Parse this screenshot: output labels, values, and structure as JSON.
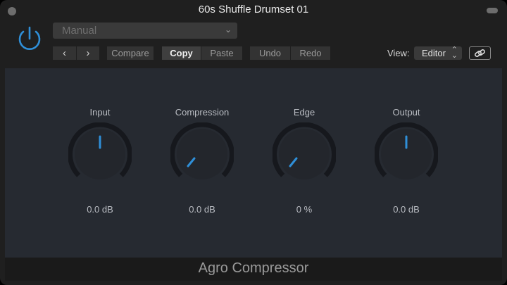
{
  "window": {
    "title": "60s Shuffle Drumset 01"
  },
  "header": {
    "preset": "Manual",
    "buttons": {
      "compare": "Compare",
      "copy": "Copy",
      "paste": "Paste",
      "undo": "Undo",
      "redo": "Redo"
    },
    "nav_prev": "‹",
    "nav_next": "›",
    "view_label": "View:",
    "view_value": "Editor"
  },
  "knobs": [
    {
      "label": "Input",
      "value": "0.0 dB"
    },
    {
      "label": "Compression",
      "value": "0.0 dB"
    },
    {
      "label": "Edge",
      "value": "0 %"
    },
    {
      "label": "Output",
      "value": "0.0 dB"
    }
  ],
  "footer": {
    "plugin_name": "Agro Compressor"
  },
  "colors": {
    "accent": "#2f8fd8",
    "panel": "#262a31",
    "background": "#1f1f1f"
  }
}
